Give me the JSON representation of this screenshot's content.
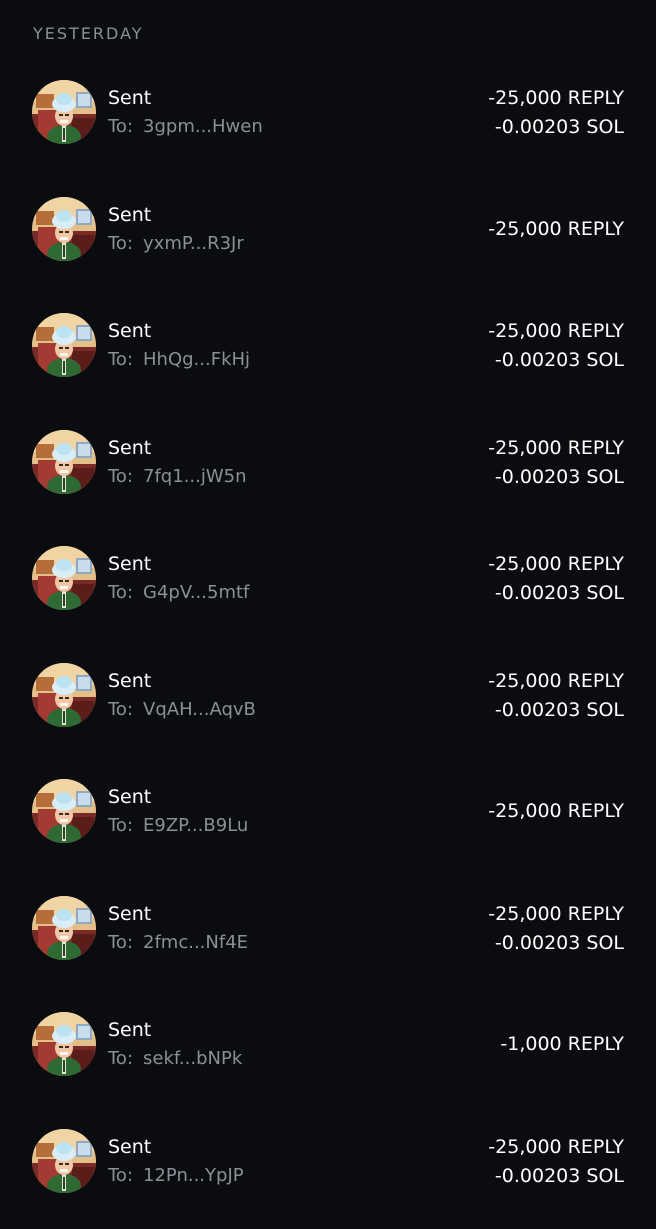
{
  "section": {
    "label": "YESTERDAY"
  },
  "transactions": [
    {
      "title": "Sent",
      "to_label": "To:",
      "address": "3gpm...Hwen",
      "amounts": [
        "-25,000 REPLY",
        "-0.00203 SOL"
      ]
    },
    {
      "title": "Sent",
      "to_label": "To:",
      "address": "yxmP...R3Jr",
      "amounts": [
        "-25,000 REPLY"
      ]
    },
    {
      "title": "Sent",
      "to_label": "To:",
      "address": "HhQg...FkHj",
      "amounts": [
        "-25,000 REPLY",
        "-0.00203 SOL"
      ]
    },
    {
      "title": "Sent",
      "to_label": "To:",
      "address": "7fq1...jW5n",
      "amounts": [
        "-25,000 REPLY",
        "-0.00203 SOL"
      ]
    },
    {
      "title": "Sent",
      "to_label": "To:",
      "address": "G4pV...5mtf",
      "amounts": [
        "-25,000 REPLY",
        "-0.00203 SOL"
      ]
    },
    {
      "title": "Sent",
      "to_label": "To:",
      "address": "VqAH...AqvB",
      "amounts": [
        "-25,000 REPLY",
        "-0.00203 SOL"
      ]
    },
    {
      "title": "Sent",
      "to_label": "To:",
      "address": "E9ZP...B9Lu",
      "amounts": [
        "-25,000 REPLY"
      ]
    },
    {
      "title": "Sent",
      "to_label": "To:",
      "address": "2fmc...Nf4E",
      "amounts": [
        "-25,000 REPLY",
        "-0.00203 SOL"
      ]
    },
    {
      "title": "Sent",
      "to_label": "To:",
      "address": "sekf...bNPk",
      "amounts": [
        "-1,000 REPLY"
      ]
    },
    {
      "title": "Sent",
      "to_label": "To:",
      "address": "12Pn...YpJP",
      "amounts": [
        "-25,000 REPLY",
        "-0.00203 SOL"
      ]
    }
  ],
  "avatar": {
    "icon": "token-avatar-icon"
  },
  "colors": {
    "background": "#0a0c0f",
    "primary_text": "#ffffff",
    "secondary_text": "#8b8f96"
  }
}
